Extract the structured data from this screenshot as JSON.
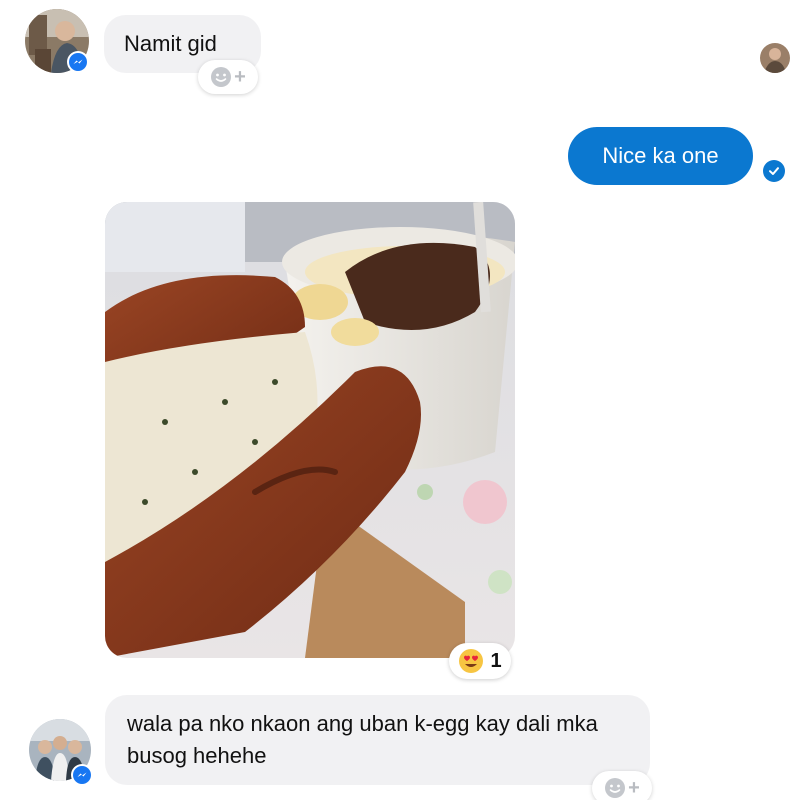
{
  "thread": {
    "messages": [
      {
        "sender": "other",
        "text": "Namit gid"
      },
      {
        "sender": "me",
        "text": "Nice ka one",
        "status": "sent"
      },
      {
        "sender": "other",
        "type": "photo",
        "image_description": "food-photo",
        "reaction": {
          "emoji": "heart-eyes",
          "count": "1"
        }
      },
      {
        "sender": "other",
        "text": "wala pa nko nkaon ang uban k-egg kay dali mka busog hehehe"
      }
    ]
  },
  "colors": {
    "accent": "#0b78d0",
    "incoming_bubble": "#f1f1f3",
    "messenger_badge": "#1877f2"
  }
}
